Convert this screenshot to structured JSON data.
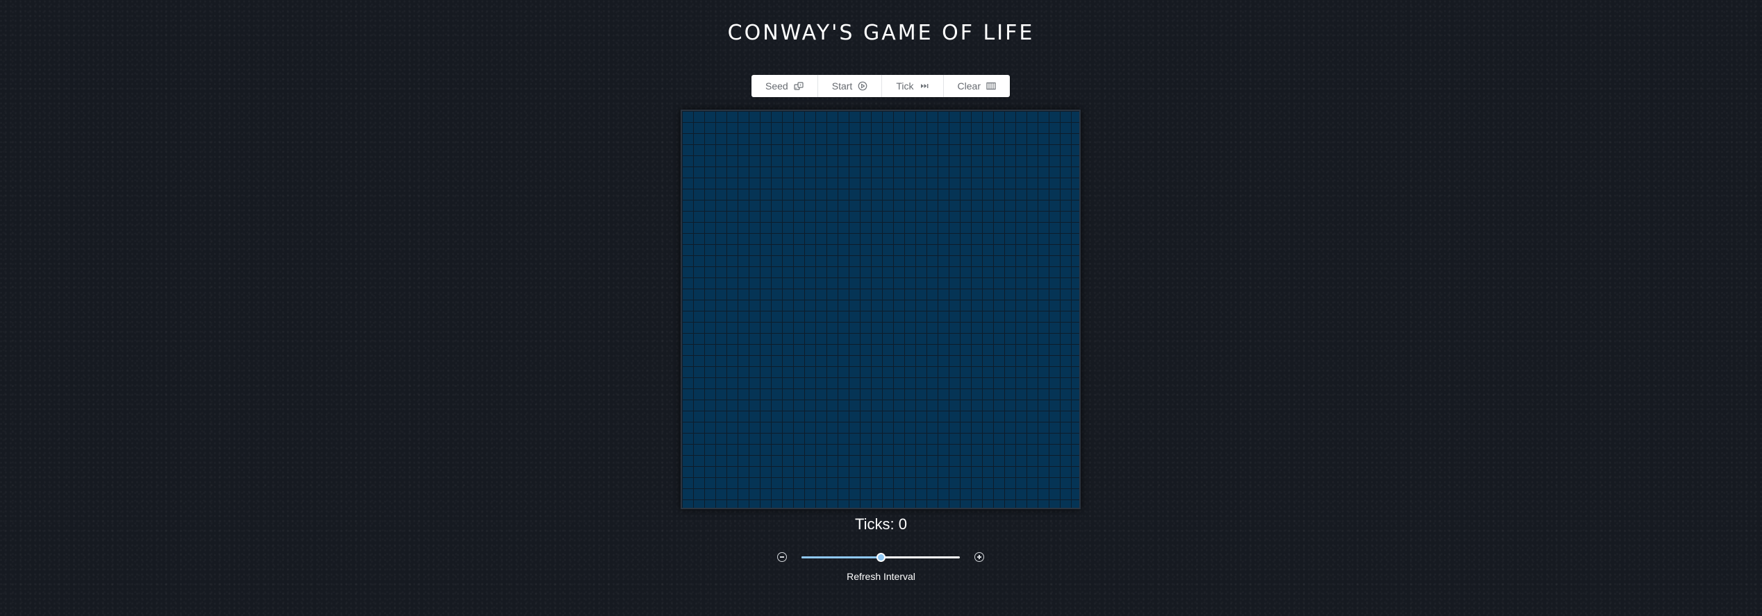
{
  "title": "Conway's Game of Life",
  "toolbar": {
    "buttons": [
      {
        "label": "Seed",
        "icon": "dice-icon"
      },
      {
        "label": "Start",
        "icon": "play-circle-icon"
      },
      {
        "label": "Tick",
        "icon": "fast-forward-icon"
      },
      {
        "label": "Clear",
        "icon": "grid-clear-icon"
      }
    ]
  },
  "board": {
    "columns": 36,
    "rows": 36,
    "cell_color": "#053455",
    "line_color": "#0d1c2a",
    "alive_cells": 0
  },
  "status": {
    "ticks_text": "Ticks: 0"
  },
  "refresh": {
    "label": "Refresh Interval",
    "value": 0.5,
    "fill_color": "#8fc8f4"
  }
}
